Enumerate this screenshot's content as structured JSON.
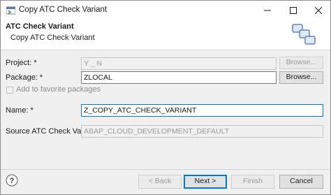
{
  "window": {
    "title": "Copy ATC Check Variant",
    "minimize_icon": "minimize-icon",
    "maximize_icon": "maximize-icon",
    "close_icon": "close-icon"
  },
  "banner": {
    "title": "ATC Check Variant",
    "subtitle": "Copy ATC Check Variant",
    "icon": "copy-variant-icon"
  },
  "form": {
    "project_label": "Project: *",
    "project_value": "Y _ N",
    "project_browse": "Browse...",
    "package_label": "Package: *",
    "package_value": "ZLOCAL",
    "package_browse": "Browse...",
    "favorite_label": "Add to favorite packages",
    "name_label": "Name: *",
    "name_value": "Z_COPY_ATC_CHECK_VARIANT",
    "source_label": "Source ATC Check Variant: *",
    "source_value": "ABAP_CLOUD_DEVELOPMENT_DEFAULT"
  },
  "footer": {
    "help_icon": "help-icon",
    "back": "< Back",
    "next": "Next >",
    "finish": "Finish",
    "cancel": "Cancel"
  },
  "colors": {
    "accent": "#0078d7",
    "window_bg": "#f0f0f0"
  }
}
